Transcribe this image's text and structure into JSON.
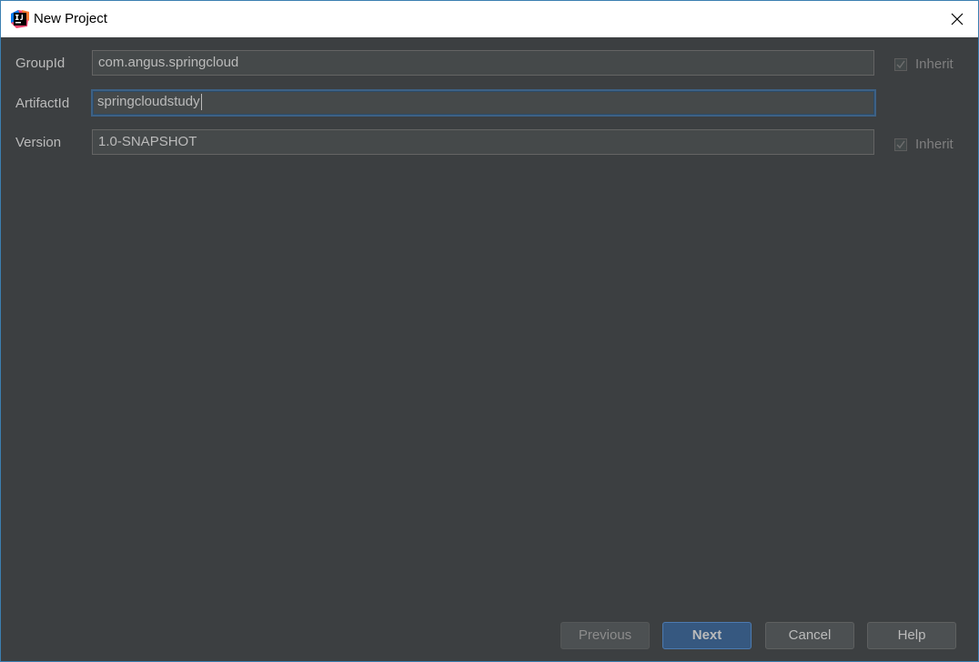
{
  "window": {
    "title": "New Project"
  },
  "form": {
    "group_id": {
      "label": "GroupId",
      "value": "com.angus.springcloud",
      "inherit_label": "Inherit",
      "inherit_checked": true
    },
    "artifact_id": {
      "label": "ArtifactId",
      "value": "springcloudstudy"
    },
    "version": {
      "label": "Version",
      "value": "1.0-SNAPSHOT",
      "inherit_label": "Inherit",
      "inherit_checked": true
    }
  },
  "buttons": {
    "previous": "Previous",
    "next": "Next",
    "cancel": "Cancel",
    "help": "Help"
  },
  "colors": {
    "background": "#3c3f41",
    "title_bar": "#ffffff",
    "field_background": "#45494a",
    "focus_border": "#3d6185",
    "primary_button": "#365880"
  }
}
